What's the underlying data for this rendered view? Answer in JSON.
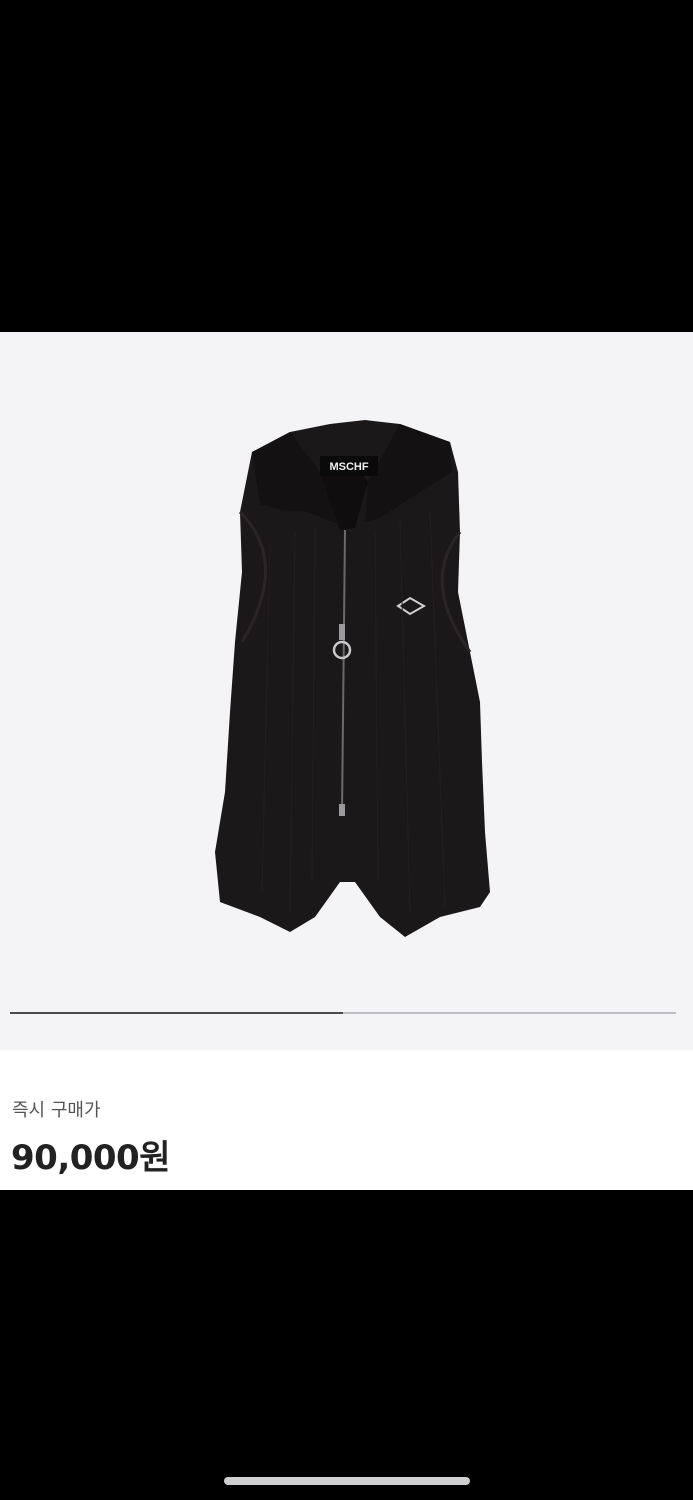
{
  "product": {
    "image_name": "black-sleeveless-zip-knit-vest",
    "brand_label": "MSCHF",
    "gallery_progress": 0.5
  },
  "price": {
    "label": "즉시 구매가",
    "value": "90,000원"
  }
}
